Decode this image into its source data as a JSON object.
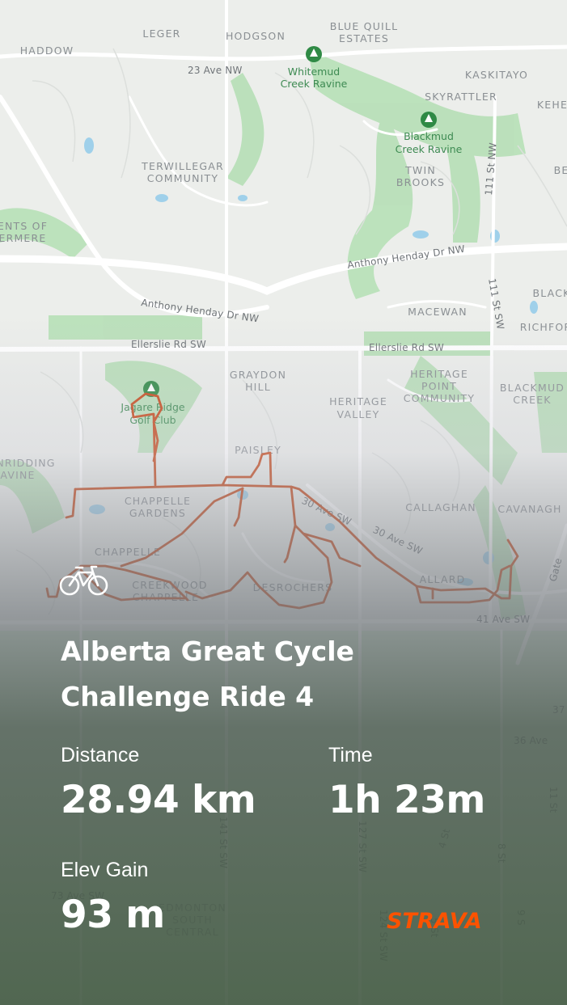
{
  "activity": {
    "title_line1": "Alberta Great Cycle",
    "title_line2": "Challenge Ride 4",
    "sport_icon": "bicycle-icon",
    "distance_label": "Distance",
    "distance_value": "28.94 km",
    "time_label": "Time",
    "time_value": "1h 23m",
    "elev_label": "Elev Gain",
    "elev_value": "93 m"
  },
  "brand": {
    "name": "STRAVA",
    "color": "#fc5200"
  },
  "route_color": "#c8491a",
  "map": {
    "neighbourhoods": [
      "LEGER",
      "HODGSON",
      "BLUE QUILL",
      "ESTATES",
      "HADDOW",
      "KASKITAYO",
      "SKYRATTLER",
      "KEHE",
      "TERWILLEGAR",
      "COMMUNITY",
      "TWIN",
      "BROOKS",
      "ENTS OF",
      "ERMERE",
      "BE",
      "BLACK",
      "MACEWAN",
      "RICHFOR",
      "GRAYDON",
      "HILL",
      "HERITAGE",
      "VALLEY",
      "HERITAGE",
      "POINT",
      "COMMUNITY",
      "BLACKMUD",
      "CREEK",
      "PAISLEY",
      "CHAPPELLE",
      "GARDENS",
      "NRIDDING",
      "AVINE",
      "CALLAGHAN",
      "CAVANAGH",
      "CHAPPELLE",
      "CREEKWOOD",
      "CHAPPELLE",
      "DESROCHERS",
      "ALLARD",
      "EDMONTON",
      "SOUTH",
      "CENTRAL"
    ],
    "roads": [
      "23 Ave NW",
      "Anthony Henday Dr NW",
      "Anthony Henday Dr NW",
      "Ellerslie Rd SW",
      "Ellerslie Rd SW",
      "111 St NW",
      "111 St SW",
      "30 Ave SW",
      "30 Ave SW",
      "41 Ave SW",
      "36 Ave",
      "37",
      "73 Ave SW",
      "141 St SW",
      "127 St SW",
      "124 St SW",
      "4 St",
      "8 St",
      "9 S",
      "5 St",
      "11 St",
      "Gate"
    ],
    "parks": [
      "Whitemud",
      "Creek Ravine",
      "Blackmud",
      "Creek Ravine",
      "Jagare Ridge",
      "Golf Club"
    ]
  }
}
